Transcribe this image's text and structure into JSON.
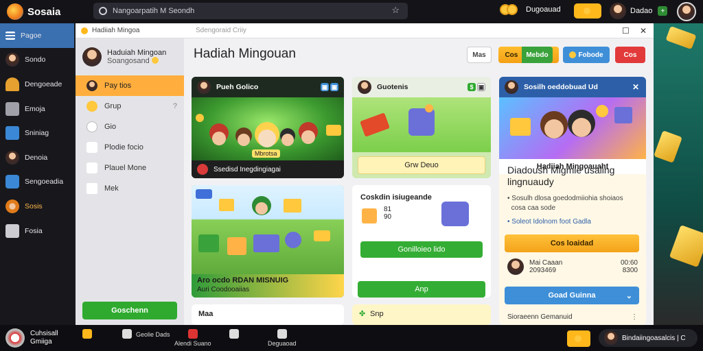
{
  "app": {
    "name": "Sosaia"
  },
  "search": {
    "value": "Nangoarpatih M Seondh"
  },
  "top": {
    "currency_value": "Dugoauad",
    "pay_label": "",
    "user_name": "Dadao"
  },
  "sidebar": {
    "items": [
      {
        "label": "Pagoe",
        "color": "#3a6fb0"
      },
      {
        "label": "Sondo",
        "color": "#c8843c"
      },
      {
        "label": "Dengoeade",
        "color": "#e5a02f"
      },
      {
        "label": "Emoja",
        "color": "#a0a0a8"
      },
      {
        "label": "Sniniag",
        "color": "#3a88d6"
      },
      {
        "label": "Denoia",
        "color": "#b84a3a"
      },
      {
        "label": "Sengoeadia",
        "color": "#3a88d6"
      },
      {
        "label": "Sosis",
        "color": "#e07a1a"
      },
      {
        "label": "Fosia",
        "color": "#ccccd2"
      }
    ]
  },
  "window": {
    "tab_title": "Hadiiah Mingoa",
    "tab_subtitle": "Sdengoraid Criiy"
  },
  "inner_nav": {
    "profile_name": "Haduiah Mingoan",
    "profile_sub": "Soangosand",
    "items": [
      {
        "label": "Pay tios"
      },
      {
        "label": "Grup"
      },
      {
        "label": "Gio"
      },
      {
        "label": "Plodie focio"
      },
      {
        "label": "Plauel Mone"
      },
      {
        "label": "Mek"
      }
    ],
    "cta_label": "Goschenn"
  },
  "page": {
    "title": "Hadiah Mingouan"
  },
  "header_buttons": {
    "b1": "Mas",
    "b2a": "Cos",
    "b2b": "Mebdo",
    "b3": "Fobode",
    "b4": "Cos"
  },
  "cards": {
    "c1": {
      "title": "Pueh Golico",
      "footer": "Ssedisd Inegdingiagai",
      "scene_label": "Mbrotsa"
    },
    "c2": {
      "title": "Guotenis",
      "button": "Grw Deuo"
    },
    "c3": {
      "title": "Sosilh oeddobuad Ud",
      "banner_label": "Hadiiah Mingoauaht",
      "headline": "Diadoush Migmie usaling lingnuaudy",
      "bullet1": "Sosulh dlosa goedodmiiohia shoiaos",
      "bullet2": "cosa caa sode",
      "bullet3": "Soleot Idolnom foot Gadla",
      "claim": "Cos loaidad",
      "row_title": "Mai Caaan",
      "row_sub": "2093469",
      "row_v1": "00:60",
      "row_v2": "8300",
      "select": "Goad Guinna",
      "footer": "Sioraeenn Gemanuid"
    },
    "c4": {
      "line1": "Aro ocdo RDAN MISNUIG",
      "line2": "Auri Coodooaiias"
    },
    "c5": {
      "title": "Coskdin isiugeande",
      "v1": "81",
      "v2": "90",
      "btn1": "Gonilloieo lido",
      "btn2": "Anp"
    },
    "c6": {
      "label": "Maa"
    },
    "c7": {
      "label": "Snp"
    }
  },
  "bottom": {
    "user_line1": "Cuhsisall",
    "user_line2": "Gmiiga",
    "tabs": [
      {
        "label": ""
      },
      {
        "label": "Geolie Dads"
      },
      {
        "label": "Alendi Suano"
      },
      {
        "label": ""
      },
      {
        "label": "Deguaoad"
      }
    ],
    "pay_label": "",
    "profile_text": "Bindaiingoasalcis | C"
  },
  "colors": {
    "accent_orange": "#ffb81c",
    "accent_green": "#34ad34",
    "accent_blue": "#3e8fd8",
    "accent_red": "#e23a3a"
  }
}
